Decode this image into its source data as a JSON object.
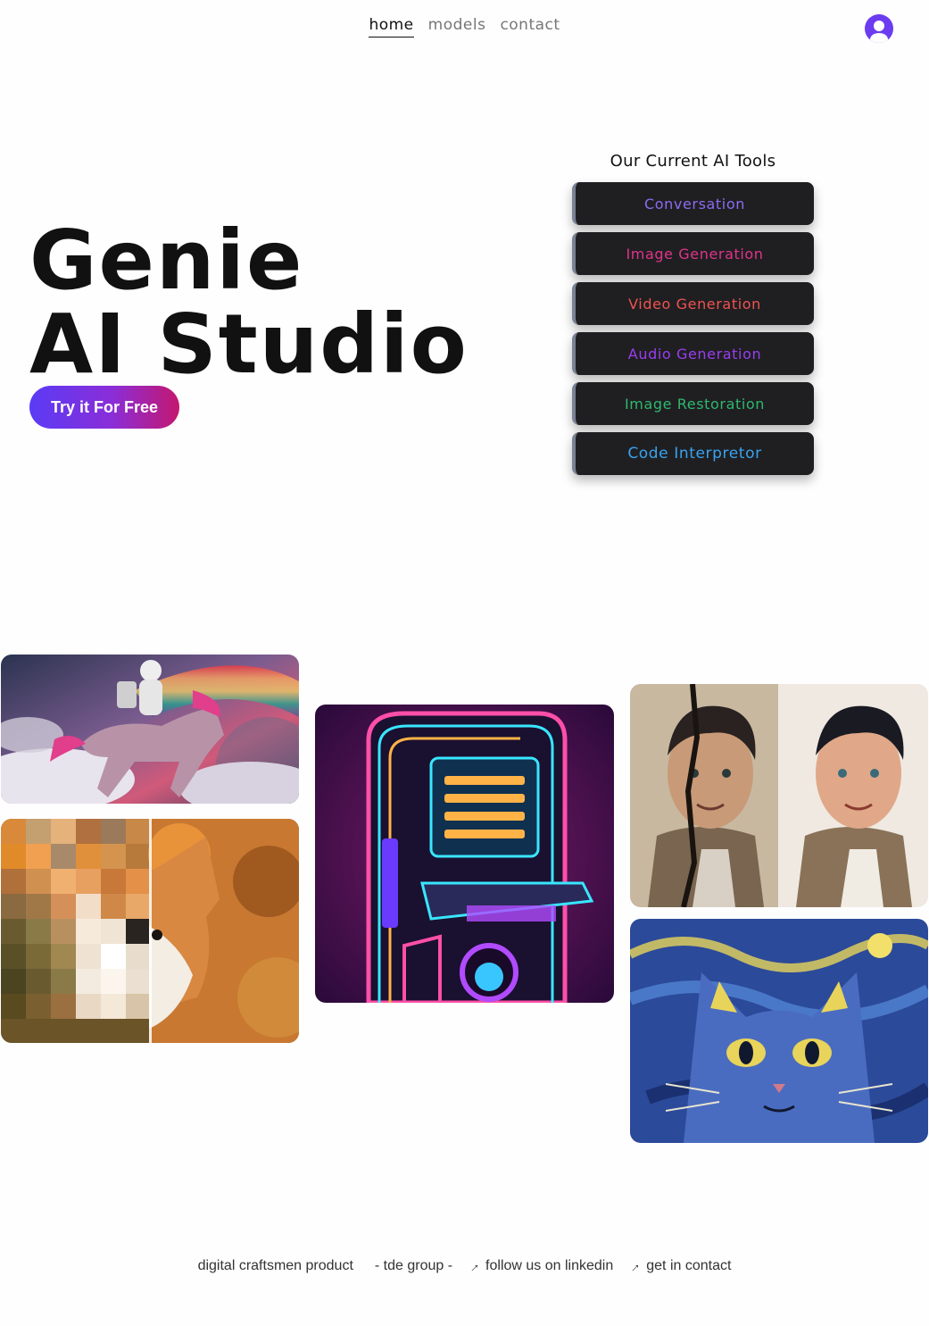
{
  "nav": {
    "items": [
      {
        "label": "home",
        "active": true
      },
      {
        "label": "models",
        "active": false
      },
      {
        "label": "contact",
        "active": false
      }
    ],
    "avatar_icon": "user-avatar-icon",
    "avatar_color": "#6b3cf0"
  },
  "hero": {
    "title_line1": "Genie",
    "title_line2": "AI Studio",
    "cta_label": "Try it For Free"
  },
  "tools": {
    "heading": "Our Current AI Tools",
    "items": [
      {
        "label": "Conversation",
        "color": "#8b6cf0"
      },
      {
        "label": "Image Generation",
        "color": "#e0338a"
      },
      {
        "label": "Video Generation",
        "color": "#ef5350"
      },
      {
        "label": "Audio Generation",
        "color": "#9b3df0"
      },
      {
        "label": "Image Restoration",
        "color": "#2fb86e"
      },
      {
        "label": "Code Interpretor",
        "color": "#39a3ee"
      }
    ]
  },
  "gallery": {
    "images": [
      {
        "name": "astronaut-unicorn-image"
      },
      {
        "name": "pixelated-dog-image"
      },
      {
        "name": "neon-arcade-image"
      },
      {
        "name": "restored-photo-image"
      },
      {
        "name": "starry-cat-image"
      }
    ]
  },
  "footer": {
    "product": "digital craftsmen product",
    "group": "- tde group -",
    "linkedin": "follow us on linkedin",
    "contact": "get in contact",
    "link_icon": "external-arrow-icon"
  }
}
